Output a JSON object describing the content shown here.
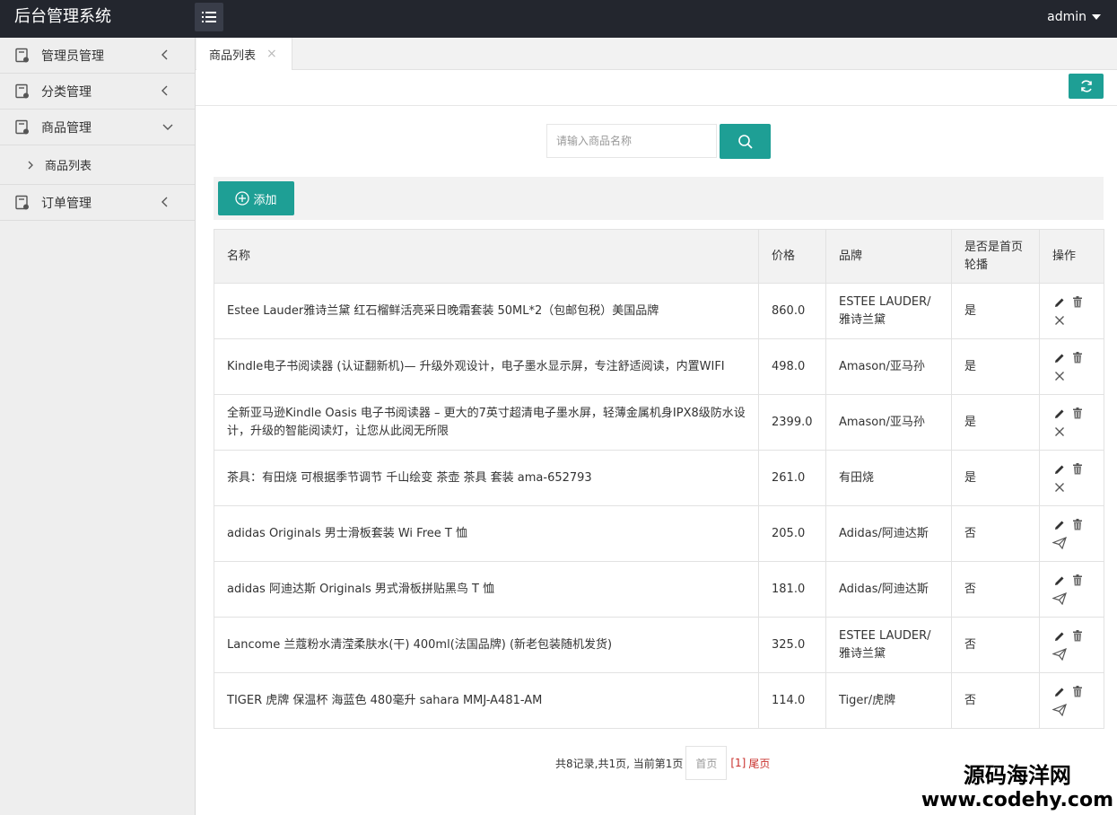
{
  "app_title": "后台管理系统",
  "user": "admin",
  "sidebar": {
    "items": [
      {
        "label": "管理员管理",
        "expanded": false
      },
      {
        "label": "分类管理",
        "expanded": false
      },
      {
        "label": "商品管理",
        "expanded": true,
        "children": [
          {
            "label": "商品列表"
          }
        ]
      },
      {
        "label": "订单管理",
        "expanded": false
      }
    ]
  },
  "tabs": [
    {
      "label": "商品列表",
      "close": "×"
    }
  ],
  "search": {
    "placeholder": "请输入商品名称",
    "value": ""
  },
  "add_label": "添加",
  "table": {
    "headers": [
      "名称",
      "价格",
      "品牌",
      "是否是首页轮播",
      "操作"
    ],
    "rows": [
      {
        "name": "Estee Lauder雅诗兰黛 红石榴鲜活亮采日晚霜套装 50ML*2（包邮包税）美国品牌",
        "price": "860.0",
        "brand": "ESTEE LAUDER/雅诗兰黛",
        "carousel": "是",
        "toggle_icon": "close-icon"
      },
      {
        "name": "Kindle电子书阅读器 (认证翻新机)— 升级外观设计，电子墨水显示屏，专注舒适阅读，内置WIFI",
        "price": "498.0",
        "brand": "Amason/亚马孙",
        "carousel": "是",
        "toggle_icon": "close-icon"
      },
      {
        "name": "全新亚马逊Kindle Oasis 电子书阅读器 – 更大的7英寸超清电子墨水屏，轻薄金属机身IPX8级防水设计，升级的智能阅读灯，让您从此阅无所限",
        "price": "2399.0",
        "brand": "Amason/亚马孙",
        "carousel": "是",
        "toggle_icon": "close-icon"
      },
      {
        "name": "茶具：有田烧 可根据季节调节 千山绘变 茶壶 茶具 套装 ama-652793",
        "price": "261.0",
        "brand": "有田烧",
        "carousel": "是",
        "toggle_icon": "close-icon"
      },
      {
        "name": "adidas Originals 男士滑板套装 Wi Free T 恤",
        "price": "205.0",
        "brand": "Adidas/阿迪达斯",
        "carousel": "否",
        "toggle_icon": "send-icon"
      },
      {
        "name": "adidas 阿迪达斯 Originals 男式滑板拼贴黑鸟 T 恤",
        "price": "181.0",
        "brand": "Adidas/阿迪达斯",
        "carousel": "否",
        "toggle_icon": "send-icon"
      },
      {
        "name": "Lancome 兰蔻粉水清滢柔肤水(干) 400ml(法国品牌) (新老包装随机发货)",
        "price": "325.0",
        "brand": "ESTEE LAUDER/雅诗兰黛",
        "carousel": "否",
        "toggle_icon": "send-icon"
      },
      {
        "name": "TIGER 虎牌 保温杯 海蓝色 480毫升 sahara MMJ-A481-AM",
        "price": "114.0",
        "brand": "Tiger/虎牌",
        "carousel": "否",
        "toggle_icon": "send-icon"
      }
    ]
  },
  "pager": {
    "summary": "共8记录,共1页, 当前第1页",
    "first": "首页",
    "current": "[1]",
    "last": "尾页"
  },
  "watermark": {
    "line1": "源码海洋网",
    "line2": "www.codehy.com"
  },
  "colors": {
    "header": "#23262e",
    "accent": "#1e9f95",
    "sidebar": "#eeeeee",
    "link_red": "#c9302c"
  }
}
